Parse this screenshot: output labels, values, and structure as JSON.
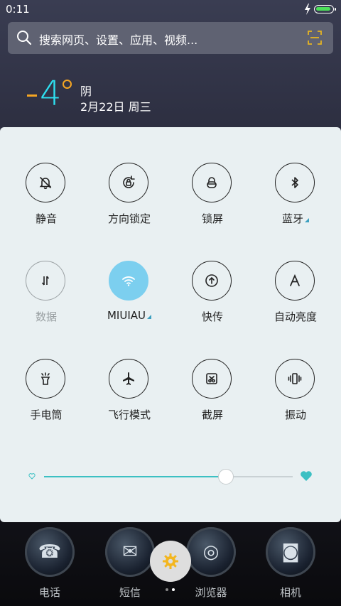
{
  "status": {
    "time": "0:11",
    "battery_level": 0.8,
    "battery_color": "#4de05a"
  },
  "search": {
    "placeholder": "搜索网页、设置、应用、视频..."
  },
  "weather": {
    "temp_sign": "-",
    "temp_value": "4",
    "condition": "阴",
    "date": "2月22日 周三"
  },
  "toggles": [
    {
      "label": "静音",
      "icon": "bell-mute-icon",
      "state": "off"
    },
    {
      "label": "方向锁定",
      "icon": "rotation-lock-icon",
      "state": "off"
    },
    {
      "label": "锁屏",
      "icon": "lock-icon",
      "state": "off"
    },
    {
      "label": "蓝牙",
      "icon": "bluetooth-icon",
      "state": "off",
      "has_more": true
    },
    {
      "label": "数据",
      "icon": "data-arrows-icon",
      "state": "disabled"
    },
    {
      "label": "MIUIAU",
      "icon": "wifi-icon",
      "state": "on",
      "has_more": true
    },
    {
      "label": "快传",
      "icon": "upload-icon",
      "state": "off"
    },
    {
      "label": "自动亮度",
      "icon": "auto-brightness-icon",
      "state": "off"
    },
    {
      "label": "手电筒",
      "icon": "flashlight-icon",
      "state": "off"
    },
    {
      "label": "飞行模式",
      "icon": "airplane-icon",
      "state": "off"
    },
    {
      "label": "截屏",
      "icon": "screenshot-icon",
      "state": "off"
    },
    {
      "label": "振动",
      "icon": "vibrate-icon",
      "state": "off"
    }
  ],
  "brightness": {
    "level": 0.73,
    "accent": "#3cc0c3"
  },
  "dock": [
    {
      "label": "电话",
      "icon": "phone-icon"
    },
    {
      "label": "短信",
      "icon": "message-icon"
    },
    {
      "label": "浏览器",
      "icon": "browser-icon"
    },
    {
      "label": "相机",
      "icon": "camera-icon"
    }
  ],
  "pager": {
    "pages": 2,
    "current": 1
  },
  "colors": {
    "wifi_active": "#7ccfef",
    "temp": "#2ee0f0",
    "temp_accent": "#f5a623",
    "scan_icon": "#e6b422"
  }
}
